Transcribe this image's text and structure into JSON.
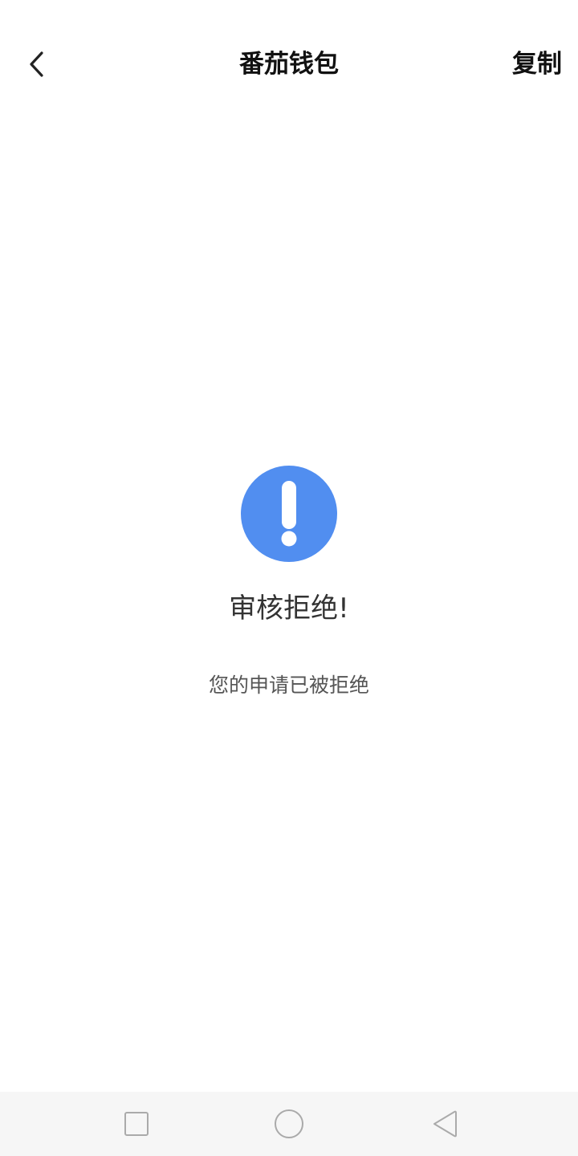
{
  "header": {
    "title": "番茄钱包",
    "copy_label": "复制",
    "back_icon": "chevron-left-icon"
  },
  "status": {
    "icon": "exclamation-circle-icon",
    "icon_color": "#518EF0",
    "title": "审核拒绝!",
    "description": "您的申请已被拒绝"
  },
  "nav_bar": {
    "background": "#f6f6f6",
    "buttons": [
      "recent-apps-icon",
      "home-icon",
      "back-triangle-icon"
    ]
  }
}
